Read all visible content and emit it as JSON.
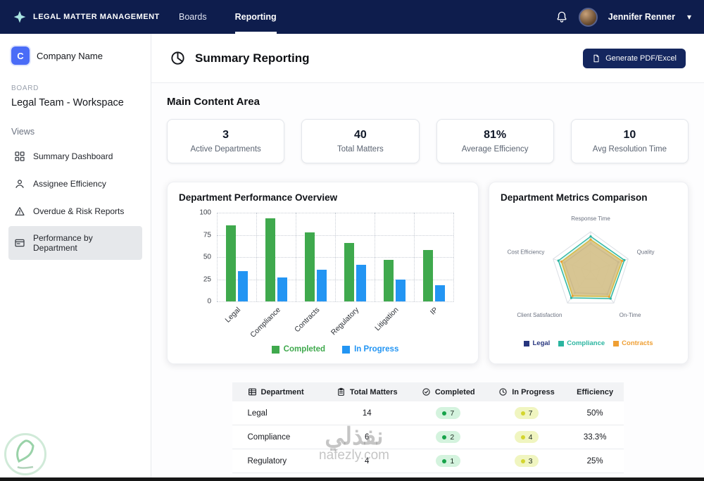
{
  "navbar": {
    "brand": "LEGAL MATTER MANAGEMENT",
    "items": [
      {
        "label": "Boards",
        "active": false
      },
      {
        "label": "Reporting",
        "active": true
      }
    ],
    "user": {
      "name": "Jennifer Renner"
    }
  },
  "sidebar": {
    "company": {
      "initial": "C",
      "name": "Company Name"
    },
    "board_label": "BOARD",
    "board_name": "Legal Team - Workspace",
    "views_label": "Views",
    "items": [
      {
        "label": "Summary Dashboard",
        "icon": "grid-icon",
        "active": false
      },
      {
        "label": "Assignee Efficiency",
        "icon": "person-icon",
        "active": false
      },
      {
        "label": "Overdue & Risk Reports",
        "icon": "warning-icon",
        "active": false
      },
      {
        "label": "Performance by Department",
        "icon": "card-icon",
        "active": true
      }
    ]
  },
  "header": {
    "title": "Summary Reporting",
    "generate_button": "Generate PDF/Excel"
  },
  "main": {
    "section_title": "Main Content Area",
    "stats": [
      {
        "value": "3",
        "label": "Active Departments"
      },
      {
        "value": "40",
        "label": "Total Matters"
      },
      {
        "value": "81%",
        "label": "Average Efficiency"
      },
      {
        "value": "10",
        "label": "Avg Resolution Time"
      }
    ]
  },
  "chart_data": [
    {
      "type": "bar",
      "title": "Department Performance Overview",
      "categories": [
        "Legal",
        "Compliance",
        "Contracts",
        "Regulatory",
        "Litigation",
        "IP"
      ],
      "series": [
        {
          "name": "Completed",
          "color": "#3fa94d",
          "values": [
            86,
            94,
            78,
            66,
            47,
            58
          ]
        },
        {
          "name": "In Progress",
          "color": "#2395f3",
          "values": [
            34,
            27,
            36,
            41,
            25,
            18
          ]
        }
      ],
      "xlabel": "",
      "ylabel": "",
      "ylim": [
        0,
        100
      ],
      "yticks": [
        100,
        75,
        50,
        25,
        0
      ],
      "grid": true,
      "legend_position": "bottom"
    },
    {
      "type": "radar",
      "title": "Department Metrics Comparison",
      "axes": [
        "Response Time",
        "Quality",
        "On-Time",
        "Client Satisfaction",
        "Cost Efficiency"
      ],
      "series": [
        {
          "name": "Legal",
          "color": "#27357e",
          "values": [
            70,
            74,
            72,
            68,
            70
          ]
        },
        {
          "name": "Compliance",
          "color": "#2ab5a0",
          "values": [
            88,
            90,
            86,
            84,
            86
          ]
        },
        {
          "name": "Contracts",
          "color": "#ef9f33",
          "fill": "#d9c38c",
          "values": [
            80,
            84,
            80,
            78,
            78
          ]
        }
      ],
      "max": 100,
      "legend_position": "bottom"
    }
  ],
  "table": {
    "columns": [
      {
        "label": "Department",
        "icon": "table-icon"
      },
      {
        "label": "Total Matters",
        "icon": "clipboard-icon"
      },
      {
        "label": "Completed",
        "icon": "check-circle-icon"
      },
      {
        "label": "In Progress",
        "icon": "clock-icon"
      },
      {
        "label": "Efficiency",
        "icon": ""
      }
    ],
    "rows": [
      {
        "department": "Legal",
        "total": "14",
        "completed": "7",
        "in_progress": "7",
        "efficiency": "50%"
      },
      {
        "department": "Compliance",
        "total": "6",
        "completed": "2",
        "in_progress": "4",
        "efficiency": "33.3%"
      },
      {
        "department": "Regulatory",
        "total": "4",
        "completed": "1",
        "in_progress": "3",
        "efficiency": "25%"
      }
    ]
  },
  "watermark": {
    "text": "نفذلي",
    "domain": "nafezly.com"
  }
}
